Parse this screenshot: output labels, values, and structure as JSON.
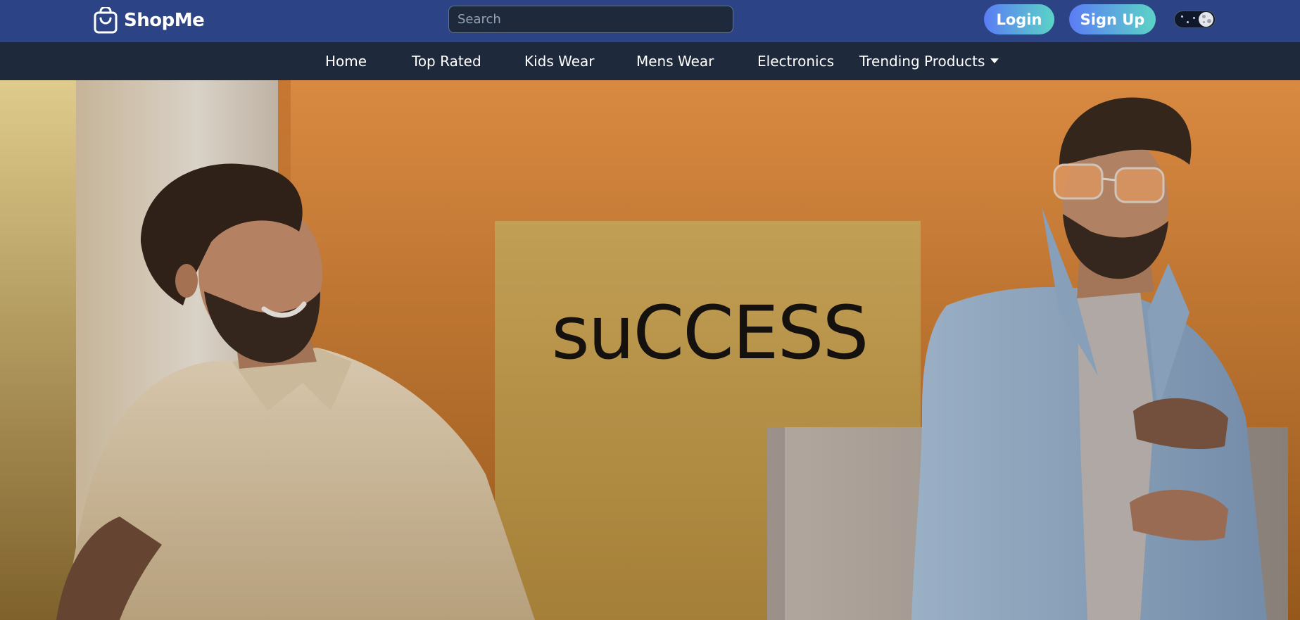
{
  "header": {
    "brand_name": "ShopMe",
    "brand_icon": "shopping-bag-icon",
    "search_placeholder": "Search",
    "login_label": "Login",
    "signup_label": "Sign Up",
    "theme_toggle_icon": "moon-toggle-icon"
  },
  "nav": {
    "items": [
      {
        "label": "Home"
      },
      {
        "label": "Top Rated"
      },
      {
        "label": "Kids Wear"
      },
      {
        "label": "Mens Wear"
      },
      {
        "label": "Electronics"
      },
      {
        "label": "Trending Products"
      }
    ],
    "dropdown_icon": "caret-down-icon"
  },
  "hero": {
    "sign_text": "suCCESS"
  },
  "colors": {
    "header_bg": "#2c4485",
    "navbar_bg": "#1e293b",
    "button_gradient_start": "#5b7cf5",
    "button_gradient_end": "#5bd4c6",
    "hero_orange": "#e8944a",
    "hero_sign_yellow": "#c9a24c"
  }
}
